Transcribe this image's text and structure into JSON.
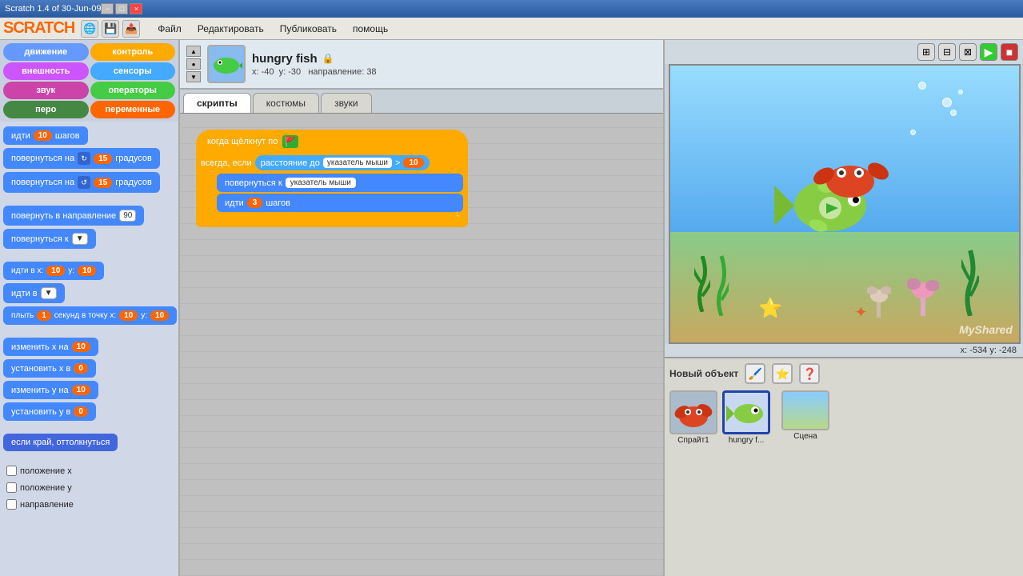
{
  "titlebar": {
    "title": "Scratch 1.4 of 30-Jun-09",
    "controls": [
      "−",
      "□",
      "×"
    ]
  },
  "menubar": {
    "logo": "SCRATCH",
    "menu_items": [
      "Файл",
      "Редактировать",
      "Публиковать",
      "помощь"
    ]
  },
  "categories": [
    {
      "label": "движение",
      "class": "cat-motion"
    },
    {
      "label": "контроль",
      "class": "cat-control"
    },
    {
      "label": "внешность",
      "class": "cat-looks"
    },
    {
      "label": "сенсоры",
      "class": "cat-sensing"
    },
    {
      "label": "звук",
      "class": "cat-sound"
    },
    {
      "label": "операторы",
      "class": "cat-operators"
    },
    {
      "label": "перо",
      "class": "cat-pen"
    },
    {
      "label": "переменные",
      "class": "cat-variables"
    }
  ],
  "blocks": [
    {
      "text": "идти",
      "val": "10",
      "suffix": "шагов",
      "type": "motion"
    },
    {
      "text": "повернуться на",
      "val": "15",
      "suffix": "градусов",
      "type": "motion_right"
    },
    {
      "text": "повернуться на",
      "val": "15",
      "suffix": "градусов",
      "type": "motion_left"
    },
    {
      "separator": true
    },
    {
      "text": "повернуть в направление",
      "val": "90",
      "type": "motion_dir"
    },
    {
      "text": "повернуться к",
      "type": "motion_to"
    },
    {
      "separator": true
    },
    {
      "text": "идти в х:",
      "val1": "10",
      "text2": "у:",
      "val2": "10",
      "type": "motion_goto"
    },
    {
      "text": "идти в",
      "type": "motion_glideto"
    },
    {
      "text": "плыть",
      "val1": "1",
      "text2": "секунд в точку х:",
      "val2": "10",
      "text3": "у:",
      "val3": "10",
      "type": "motion_glide"
    },
    {
      "separator": true
    },
    {
      "text": "изменить х на",
      "val": "10",
      "type": "motion_changex"
    },
    {
      "text": "установить х в",
      "val": "0",
      "type": "motion_setx"
    },
    {
      "text": "изменить у на",
      "val": "10",
      "type": "motion_changey"
    },
    {
      "text": "установить у в",
      "val": "0",
      "type": "motion_sety"
    },
    {
      "separator": true
    },
    {
      "text": "если край, оттолкнуться",
      "type": "motion_bounce"
    },
    {
      "separator": true
    },
    {
      "checkbox": true,
      "text": "положение х",
      "type": "motion_xpos"
    },
    {
      "checkbox": true,
      "text": "положение у",
      "type": "motion_ypos"
    },
    {
      "checkbox": true,
      "text": "направление",
      "type": "motion_dir_report"
    }
  ],
  "sprite": {
    "name": "hungry fish",
    "x": "-40",
    "y": "-30",
    "direction": "38"
  },
  "tabs": [
    {
      "label": "скрипты",
      "active": true
    },
    {
      "label": "костюмы",
      "active": false
    },
    {
      "label": "звуки",
      "active": false
    }
  ],
  "scripts": {
    "hat_label": "когда щёлкнут по",
    "forever_label": "всегда, если",
    "condition_label": "расстояние до",
    "condition_arg": "указатель мыши",
    "condition_op": ">",
    "condition_val": "10",
    "turn_label": "повернуться к",
    "turn_arg": "указатель мыши",
    "move_label": "идти",
    "move_val": "3",
    "move_suffix": "шагов"
  },
  "stage": {
    "coords": "x: -534   y: -248"
  },
  "sprite_tray": {
    "new_object_label": "Новый объект",
    "sprites": [
      {
        "label": "Спрайт1",
        "emoji": "🦀"
      },
      {
        "label": "hungry f...",
        "emoji": "🐟",
        "active": true
      }
    ],
    "scene_label": "Сцена"
  }
}
